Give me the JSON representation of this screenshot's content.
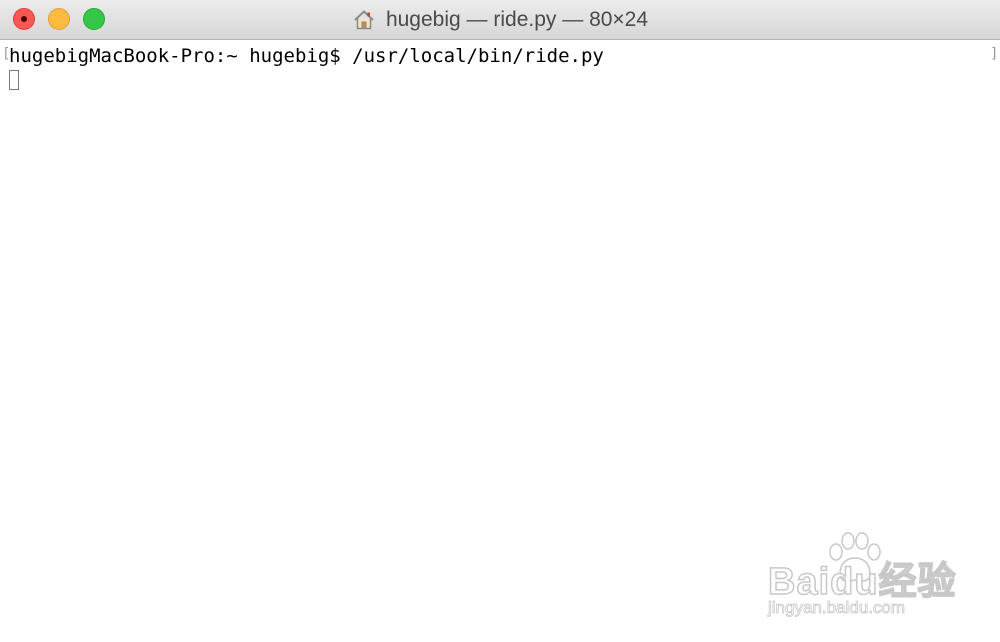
{
  "window": {
    "title": "hugebig — ride.py — 80×24"
  },
  "icons": {
    "home": "house-icon"
  },
  "terminal": {
    "bracket_left": "[",
    "bracket_right": "]",
    "lines": [
      "hugebigMacBook-Pro:~ hugebig$ /usr/local/bin/ride.py"
    ]
  },
  "watermark": {
    "brand": "Baidu经验",
    "url": "jingyan.baidu.com"
  },
  "colors": {
    "close": "#fc5753",
    "minimize": "#fdbc40",
    "zoom": "#34c748"
  }
}
